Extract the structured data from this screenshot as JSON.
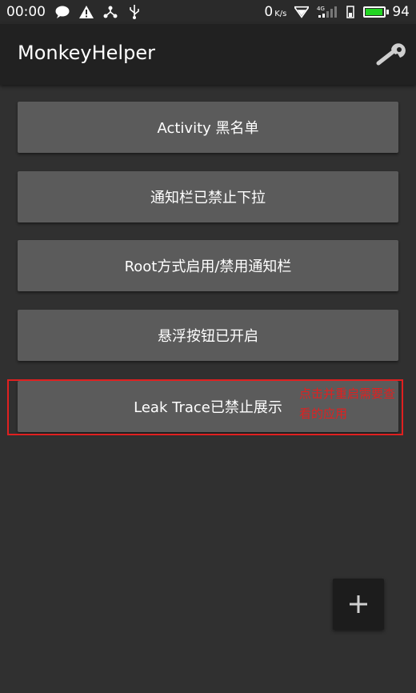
{
  "status_bar": {
    "time": "00:00",
    "icons_left": [
      "chat-bubble-icon",
      "warning-icon",
      "share-icon",
      "usb-icon"
    ],
    "net_speed_value": "0",
    "net_speed_unit": "K/s",
    "network_label": "4G",
    "battery_level": "94",
    "battery_color": "#22d422"
  },
  "app_bar": {
    "title": "MonkeyHelper",
    "settings_icon": "wrench-icon"
  },
  "buttons": [
    {
      "label": "Activity 黑名单"
    },
    {
      "label": "通知栏已禁止下拉"
    },
    {
      "label": "Root方式启用/禁用通知栏"
    },
    {
      "label": "悬浮按钮已开启"
    },
    {
      "label": "Leak Trace已禁止展示"
    }
  ],
  "annotation": {
    "text": "点击并重启需要查看的应用",
    "color": "#e02020"
  },
  "fab": {
    "icon": "plus-icon"
  }
}
